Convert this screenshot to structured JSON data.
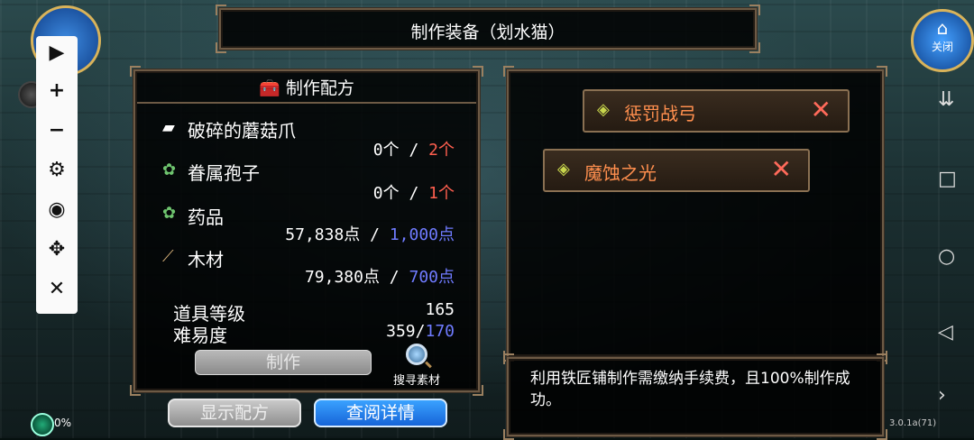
{
  "window_title": "制作装备（划水猫）",
  "recipe": {
    "header": "制作配方",
    "materials": [
      {
        "name": "破碎的蘑菇爪",
        "icon": "ore-icon",
        "have": "0个",
        "sep": " / ",
        "need": "2个",
        "need_color": "#ff5f4f"
      },
      {
        "name": "眷属孢子",
        "icon": "herb-icon",
        "have": "0个",
        "sep": " / ",
        "need": "1个",
        "need_color": "#ff5f4f"
      },
      {
        "name": "药品",
        "icon": "herb-icon",
        "have": "57,838点",
        "sep": " / ",
        "need": "1,000点",
        "need_color": "#6f7bff"
      },
      {
        "name": "木材",
        "icon": "wood-icon",
        "have": "79,380点",
        "sep": " / ",
        "need": "700点",
        "need_color": "#6f7bff"
      }
    ],
    "item_level_label": "道具等级",
    "item_level_value": "165",
    "difficulty_label": "难易度",
    "difficulty_value": "359/",
    "difficulty_max": "170",
    "craft_label": "制作",
    "search_label": "搜寻素材"
  },
  "buttons": {
    "show_recipe": "显示配方",
    "view_details": "查阅详情"
  },
  "results": [
    {
      "name": "惩罚战弓",
      "icon": "leaf-icon"
    },
    {
      "name": "魔蚀之光",
      "icon": "leaf-icon"
    }
  ],
  "info_text": "利用铁匠铺制作需缴纳手续费，且100%制作成功。",
  "hud": {
    "close_label": "关闭",
    "percent": "0%",
    "version": "3.0.1a(71)"
  }
}
